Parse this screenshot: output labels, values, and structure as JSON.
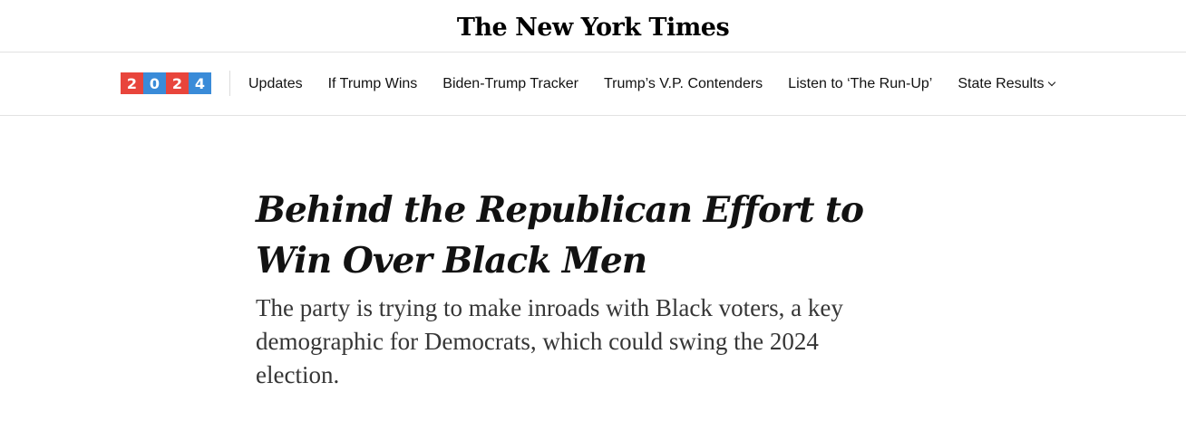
{
  "masthead": {
    "logo_text": "The New York Times"
  },
  "nav": {
    "badge": {
      "digits": [
        "2",
        "0",
        "2",
        "4"
      ],
      "colors": [
        "#e8453c",
        "#3a8bd8",
        "#e8453c",
        "#3a8bd8"
      ]
    },
    "links": [
      {
        "label": "Updates"
      },
      {
        "label": "If Trump Wins"
      },
      {
        "label": "Biden-Trump Tracker"
      },
      {
        "label": "Trump’s V.P. Contenders"
      },
      {
        "label": "Listen to ‘The Run-Up’"
      },
      {
        "label": "State Results",
        "icon": "chevron-down-icon"
      }
    ]
  },
  "article": {
    "headline": "Behind the Republican Effort to Win Over Black Men",
    "summary": "The party is trying to make inroads with Black voters, a key demographic for Democrats, which could swing the 2024 election."
  }
}
